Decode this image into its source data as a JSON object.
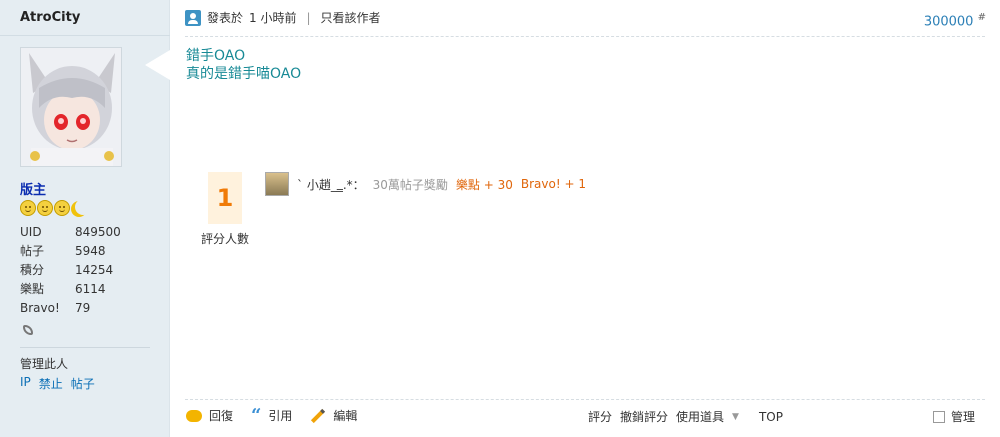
{
  "sidebar": {
    "username": "AtroCity",
    "rank": "版主",
    "stats": [
      {
        "label": "UID",
        "value": "849500"
      },
      {
        "label": "帖子",
        "value": "5948"
      },
      {
        "label": "積分",
        "value": "14254"
      },
      {
        "label": "樂點",
        "value": "6114"
      },
      {
        "label": "Bravo!",
        "value": "79"
      }
    ],
    "manage_label": "管理此人",
    "manage_links": [
      "IP",
      "禁止",
      "帖子"
    ]
  },
  "post": {
    "posted_label": "發表於",
    "time": "1 小時前",
    "author_only": "只看該作者",
    "floor": "300000",
    "floor_mark": "#",
    "content_lines": [
      "錯手OAO",
      "真的是錯手喵OAO"
    ]
  },
  "rating": {
    "count": "1",
    "count_label": "評分人數",
    "user": "ˋ 小趙_‗.*：",
    "reason": "30萬帖子獎勵",
    "points": "樂點 + 30",
    "bravo": "Bravo! + 1"
  },
  "actions": {
    "reply": "回復",
    "quote": "引用",
    "edit": "編輯",
    "rate": "評分",
    "cancel_rate": "撤銷評分",
    "use_item": "使用道具",
    "top": "TOP",
    "manage": "管理"
  }
}
